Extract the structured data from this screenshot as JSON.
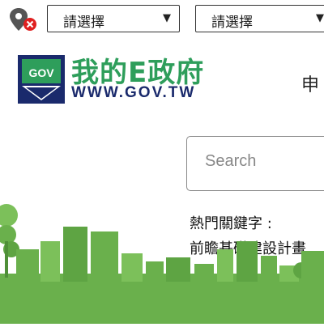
{
  "selects": [
    {
      "value": "請選擇"
    },
    {
      "value": "請選擇"
    }
  ],
  "logo": {
    "badge_text": "GOV",
    "title": "我的E政府",
    "url": "WWW.GOV.TW"
  },
  "nav": {
    "partial_item": "申"
  },
  "search": {
    "placeholder": "Search"
  },
  "hot_keywords": {
    "label": "熱門關鍵字 :",
    "items": [
      "前瞻基礎建設計畫"
    ]
  },
  "colors": {
    "brand_green": "#2e9e5b",
    "brand_navy": "#1a2a6c",
    "skyline_green": "#6ab04c",
    "location_icon_red": "#e02020"
  },
  "icons": [
    "location-pin-off-icon",
    "chevron-down-icon"
  ]
}
